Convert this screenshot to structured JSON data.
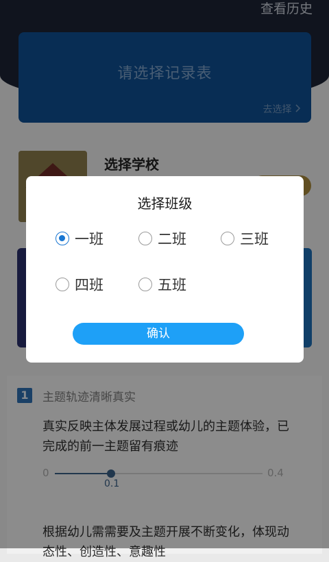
{
  "header": {
    "history_label": "查看历史"
  },
  "record_card": {
    "title": "请选择记录表",
    "go_label": "去选择",
    "arrow": "chevron-right-icon"
  },
  "school": {
    "title": "选择学校"
  },
  "criteria": {
    "number": "1",
    "title": "主题轨迹清晰真实",
    "description": "真实反映主体发展过程或幼儿的主题体验，已完成的前一主题留有痕迹",
    "slider": {
      "min": "0",
      "max": "0.4",
      "value": "0.1",
      "fraction": 0.27
    },
    "description2": "根据幼儿需需要及主题开展不断变化，体现动态性、创造性、意趣性"
  },
  "dialog": {
    "title": "选择班级",
    "options": [
      {
        "label": "一班",
        "checked": true
      },
      {
        "label": "二班",
        "checked": false
      },
      {
        "label": "三班",
        "checked": false
      },
      {
        "label": "四班",
        "checked": false
      },
      {
        "label": "五班",
        "checked": false
      }
    ],
    "confirm_label": "确认"
  },
  "colors": {
    "accent": "#1ea0f7",
    "radio_checked": "#1976d2",
    "header_bg": "#1c2434"
  }
}
